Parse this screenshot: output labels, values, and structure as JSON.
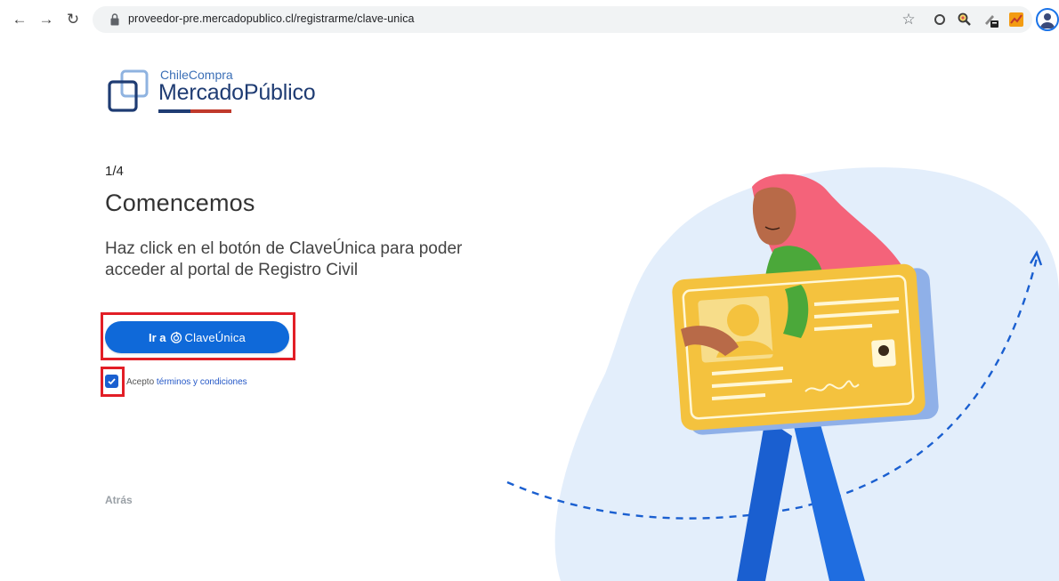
{
  "browser": {
    "url": "proveedor-pre.mercadopublico.cl/registrarme/clave-unica"
  },
  "logo": {
    "small_text": "ChileCompra",
    "big_text": "MercadoPúblico"
  },
  "content": {
    "step": "1/4",
    "title": "Comencemos",
    "description": "Haz click en el botón de ClaveÚnica para poder acceder al portal de Registro Civil",
    "button_prefix": "Ir a",
    "button_brand": "ClaveÚnica",
    "terms_prefix": "Acepto",
    "terms_link": "términos y condiciones",
    "terms_checked": true,
    "back_label": "Atrás"
  },
  "colors": {
    "primary_button": "#0f69d9",
    "highlight_border": "#e21e26",
    "logo_blue": "#1f3c73"
  }
}
